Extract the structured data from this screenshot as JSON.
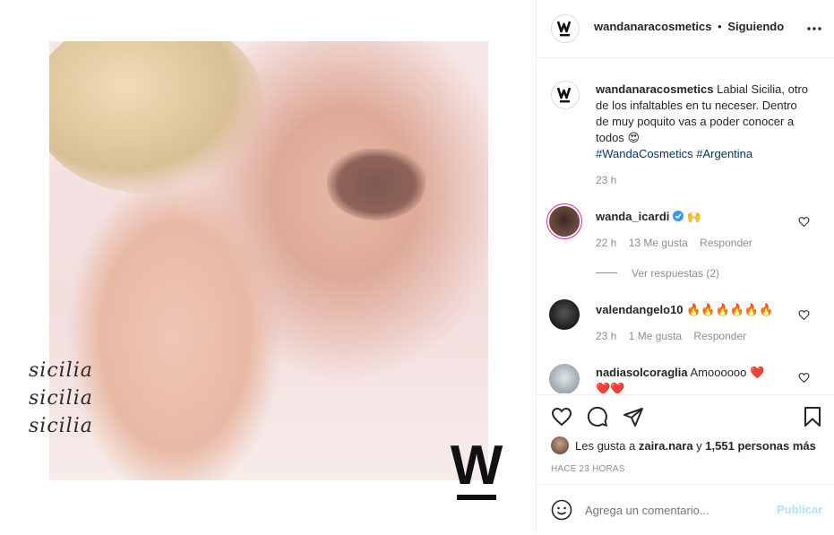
{
  "media": {
    "script_lines": [
      "sicilia",
      "sicilia",
      "sicilia"
    ],
    "brand_logo_letter": "W"
  },
  "header": {
    "username": "wandanaracosmetics",
    "separator": "•",
    "follow_status": "Siguiendo",
    "more_icon": "more-horizontal-icon"
  },
  "caption": {
    "username": "wandanaracosmetics",
    "text": "Labial Sicilia, otro de los infaltables en tu neceser. Dentro de muy poquito vas a poder conocer a todos",
    "emoji": "😍",
    "hashtags": [
      "#WandaCosmetics",
      "#Argentina"
    ],
    "time": "23 h"
  },
  "comments": [
    {
      "username": "wanda_icardi",
      "verified": true,
      "text": "🙌",
      "time": "22 h",
      "likes": "13 Me gusta",
      "reply": "Responder",
      "view_replies": "Ver respuestas (2)"
    },
    {
      "username": "valendangelo10",
      "text": "🔥🔥🔥🔥🔥🔥",
      "time": "23 h",
      "likes": "1 Me gusta",
      "reply": "Responder"
    },
    {
      "username": "nadiasolcoraglia",
      "text": "Amoooooo ❤️",
      "text_line2": "❤️❤️"
    }
  ],
  "actions": {
    "likes_prefix": "Les gusta a",
    "likes_user": "zaira.nara",
    "likes_and": "y",
    "likes_count": "1,551 personas más",
    "time_ago": "HACE 23 HORAS"
  },
  "add_comment": {
    "placeholder": "Agrega un comentario...",
    "publish": "Publicar"
  },
  "colors": {
    "link": "#00376b",
    "verified": "#3897f0",
    "publish_disabled": "#b2dffc",
    "heart_red": "#ed4956"
  }
}
